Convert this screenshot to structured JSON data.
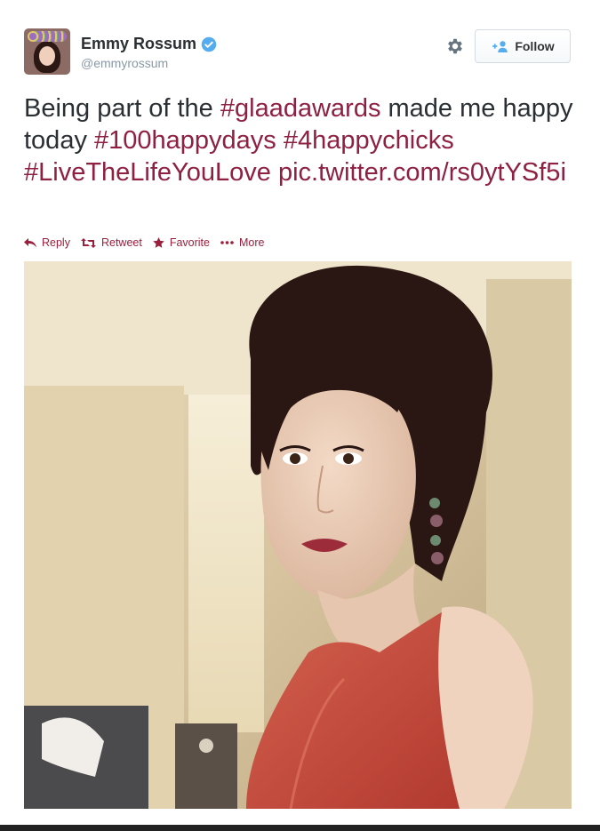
{
  "tweet": {
    "author": {
      "display_name": "Emmy Rossum",
      "handle": "@emmyrossum",
      "verified": true
    },
    "follow_label": "Follow",
    "text_parts": [
      {
        "type": "text",
        "text": "Being part of the "
      },
      {
        "type": "tag",
        "text": "#glaadawards"
      },
      {
        "type": "text",
        "text": " made me happy today "
      },
      {
        "type": "tag",
        "text": "#100happydays"
      },
      {
        "type": "text",
        "text": " "
      },
      {
        "type": "tag",
        "text": "#4happychicks"
      },
      {
        "type": "text",
        "text": " "
      },
      {
        "type": "tag",
        "text": "#LiveTheLifeYouLove"
      },
      {
        "type": "text",
        "text": " "
      },
      {
        "type": "link",
        "text": "pic.twitter.com/rs0ytYSf5i"
      }
    ],
    "actions": {
      "reply": "Reply",
      "retweet": "Retweet",
      "favorite": "Favorite",
      "more": "More"
    }
  },
  "icons": {
    "gear": "gear-icon",
    "follow": "add-user-icon",
    "verified": "verified-badge-icon",
    "reply": "reply-icon",
    "retweet": "retweet-icon",
    "favorite": "star-icon",
    "more": "ellipsis-icon"
  },
  "colors": {
    "link": "#8e2041",
    "verified": "#55acee",
    "action": "#9a1f3c",
    "handle": "#8899a6"
  }
}
